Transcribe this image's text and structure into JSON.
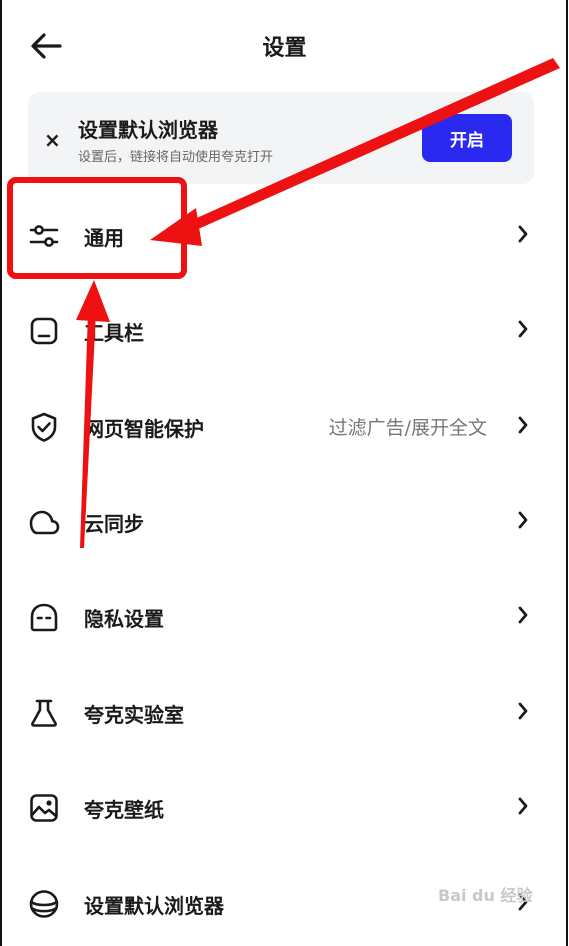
{
  "header": {
    "back_icon": "arrow-left-icon",
    "title": "设置"
  },
  "banner": {
    "close_symbol": "×",
    "title": "设置默认浏览器",
    "subtitle": "设置后，链接将自动使用夸克打开",
    "button_label": "开启",
    "button_color": "#2929f0"
  },
  "menu": {
    "items": [
      {
        "icon": "sliders-icon",
        "label": "通用",
        "value": ""
      },
      {
        "icon": "toolbar-icon",
        "label": "工具栏",
        "value": ""
      },
      {
        "icon": "shield-check-icon",
        "label": "网页智能保护",
        "value": "过滤广告/展开全文"
      },
      {
        "icon": "cloud-icon",
        "label": "云同步",
        "value": ""
      },
      {
        "icon": "privacy-face-icon",
        "label": "隐私设置",
        "value": ""
      },
      {
        "icon": "flask-icon",
        "label": "夸克实验室",
        "value": ""
      },
      {
        "icon": "wallpaper-icon",
        "label": "夸克壁纸",
        "value": ""
      },
      {
        "icon": "database-icon",
        "label": "设置默认浏览器",
        "value": ""
      }
    ]
  },
  "annotation": {
    "color": "#ee1111"
  },
  "watermark": {
    "text": "Bai du 经验"
  }
}
